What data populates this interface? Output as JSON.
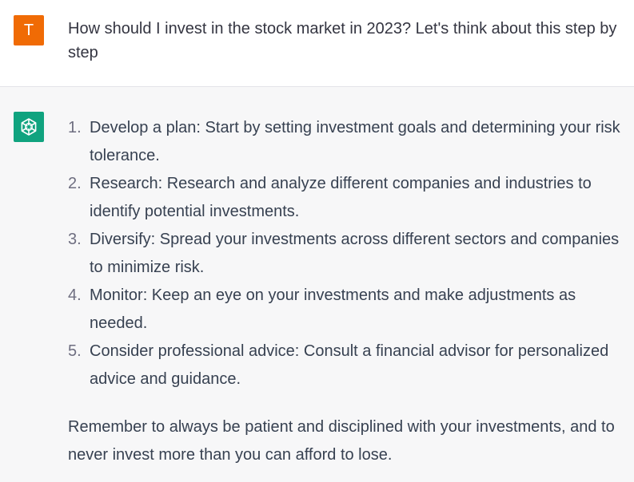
{
  "user_message": {
    "avatar_letter": "T",
    "avatar_color": "#f06b05",
    "text": "How should I invest in the stock market in 2023? Let's think about this step by step"
  },
  "assistant_message": {
    "avatar_icon": "openai-logo-icon",
    "avatar_color": "#10a37f",
    "steps": [
      {
        "number": "1.",
        "text": "Develop a plan: Start by setting investment goals and determining your risk tolerance."
      },
      {
        "number": "2.",
        "text": "Research: Research and analyze different companies and industries to identify potential investments."
      },
      {
        "number": "3.",
        "text": "Diversify: Spread your investments across different sectors and companies to minimize risk."
      },
      {
        "number": "4.",
        "text": "Monitor: Keep an eye on your investments and make adjustments as needed."
      },
      {
        "number": "5.",
        "text": "Consider professional advice: Consult a financial advisor for personalized advice and guidance."
      }
    ],
    "closing": "Remember to always be patient and disciplined with your investments, and to never invest more than you can afford to lose."
  }
}
